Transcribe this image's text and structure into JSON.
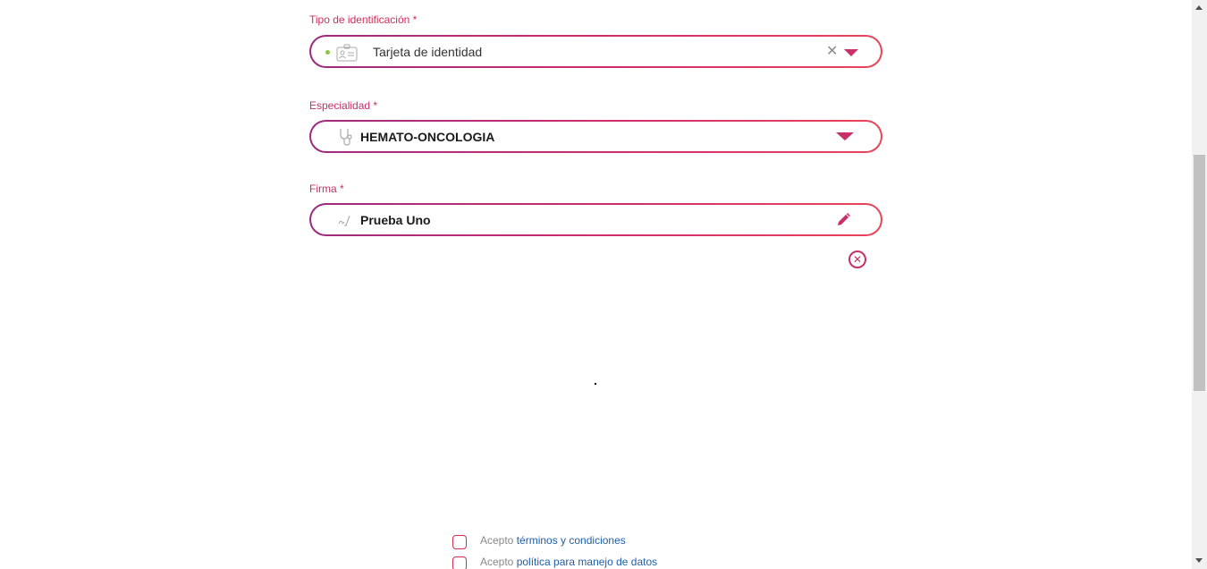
{
  "form": {
    "id_type": {
      "label": "Tipo de identificación *",
      "value": "Tarjeta de identidad",
      "icon": "id-card-icon",
      "clear_glyph": "✕"
    },
    "specialty": {
      "label": "Especialidad *",
      "value": "HEMATO-ONCOLOGIA",
      "icon": "stethoscope-icon"
    },
    "signature": {
      "label": "Firma *",
      "value": "Prueba Uno",
      "icon": "signature-icon",
      "edit_icon": "pencil-icon",
      "remove_glyph": "✕"
    }
  },
  "consents": [
    {
      "prefix": "Acepto",
      "link": "términos y condiciones"
    },
    {
      "prefix": "Acepto",
      "link": "política para manejo de datos"
    }
  ],
  "colors": {
    "accent": "#c8306c",
    "accent_purple": "#9c2b7e",
    "link": "#1f5ea8",
    "status_dot": "#8cc63f"
  }
}
